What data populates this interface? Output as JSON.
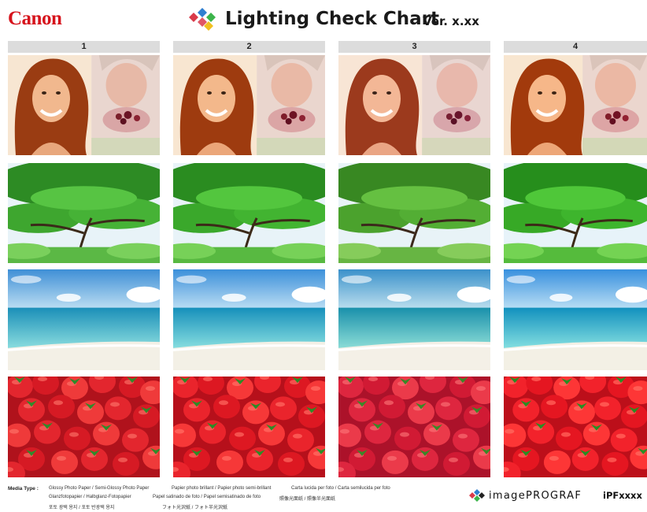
{
  "brand": {
    "logo": "Canon"
  },
  "header": {
    "title": "Lighting Check Chart",
    "version": "Ver. x.xx",
    "icon": "color-diamonds-icon"
  },
  "columns": [
    {
      "label": "1"
    },
    {
      "label": "2"
    },
    {
      "label": "3"
    },
    {
      "label": "4"
    }
  ],
  "rows": [
    {
      "subject": "portrait-woman-and-flowers"
    },
    {
      "subject": "green-pine-tree"
    },
    {
      "subject": "beach-seascape"
    },
    {
      "subject": "strawberries"
    }
  ],
  "footer": {
    "media_type_label": "Media Type :",
    "media_lines": [
      "Glossy Photo Paper / Semi-Glossy Photo Paper",
      "Papier photo brillant / Papier photo semi-brillant",
      "Carta lucida per foto / Carta semilucida per foto",
      "Glanzfotopapier / Halbglanz-Fotopapier",
      "Papel satinado de foto / Papel semisatinado de foto",
      "照像光面纸 / 照像半光面纸",
      "포토 광택 용지 / 포토 반광택 용지",
      "フォト光沢紙 / フォト半光沢紙"
    ],
    "product_brand": "imagePROGRAF",
    "model": "iPFxxxx"
  },
  "colors": {
    "canon_red": "#d6131c",
    "header_bar": "#dcdcdc",
    "diamond_red": "#d93a4a",
    "diamond_blue": "#2f7fd0",
    "diamond_green": "#3cb44b",
    "diamond_yellow": "#f0c020"
  }
}
